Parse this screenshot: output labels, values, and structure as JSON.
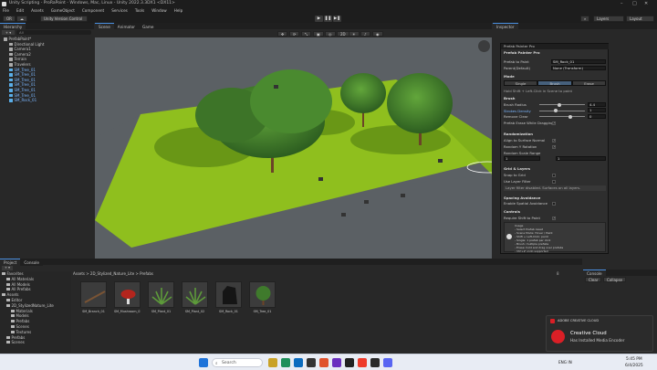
{
  "window": {
    "title": "Unity Scripting - ProRaPoint - Windows, Mac, Linux - Unity 2022.3.3DX1 <DX11>",
    "controls": [
      "–",
      "□",
      "✕"
    ]
  },
  "menu": [
    "File",
    "Edit",
    "Assets",
    "GameObject",
    "Component",
    "Services",
    "Tools",
    "Window",
    "Help"
  ],
  "toolbar": {
    "account": "OR",
    "cloud": "☁",
    "package_label": "Unity Version Control",
    "layers": "Layers",
    "layout": "Layout",
    "search_glyph": "⌕",
    "play": "▶",
    "pause": "❚❚",
    "step": "▶❚"
  },
  "hierarchy": {
    "title": "Hierarchy",
    "add": "+ ▾",
    "search_placeholder": "All",
    "items": [
      {
        "label": "PrefabPaint*",
        "type": "scene"
      },
      {
        "label": "Directional Light",
        "type": "go"
      },
      {
        "label": "Camera1",
        "type": "go"
      },
      {
        "label": "Camera2",
        "type": "go"
      },
      {
        "label": "Terrain",
        "type": "go"
      },
      {
        "label": "Travelers",
        "type": "go"
      },
      {
        "label": "SM_Tree_01",
        "type": "prefab"
      },
      {
        "label": "SM_Tree_01",
        "type": "prefab"
      },
      {
        "label": "SM_Tree_01",
        "type": "prefab"
      },
      {
        "label": "SM_Tree_01",
        "type": "prefab"
      },
      {
        "label": "SM_Tree_01",
        "type": "prefab"
      },
      {
        "label": "SM_Tree_01",
        "type": "prefab"
      },
      {
        "label": "SM_Rock_01",
        "type": "prefab"
      }
    ]
  },
  "scene": {
    "tabs": [
      "Scene",
      "Animator",
      "Game"
    ],
    "tool_labels": [
      "✥",
      "⟳",
      "⤡",
      "▣",
      "◎",
      "2D",
      "☀",
      "♪",
      "◉"
    ],
    "persp": "< Persp"
  },
  "inspector": {
    "title": "Inspector"
  },
  "overlay": {
    "title": "Prefab Painter Pro",
    "subtitle": "Prefab Painter Pro",
    "prefab_label": "Prefab to Paint",
    "prefab_value": "SM_Rock_01",
    "parent_label": "Parent(Default)",
    "parent_value": "None (Transform)",
    "mode_label": "Mode",
    "modes": [
      "Single",
      "Brush",
      "Erase"
    ],
    "active_mode": 1,
    "hint": "Hold Shift + Left-Click in Scene to paint",
    "brush_label": "Brush",
    "fields": [
      {
        "label": "Brush Radius",
        "value": "4.4"
      },
      {
        "label": "Strokes Density",
        "value": "1"
      },
      {
        "label": "Remove Clear",
        "value": "0"
      }
    ],
    "strokes_dropdown": "Prefab Erase While Dragging",
    "randomization_label": "Randomization",
    "rand_items": [
      {
        "label": "Align to Surface Normal",
        "checked": true
      },
      {
        "label": "Random Y Rotation",
        "checked": true
      }
    ],
    "scale_label": "Random Scale Range",
    "scale_min": "1",
    "scale_max": "1",
    "grid_label": "Grid & Layers",
    "grid_items": [
      {
        "label": "Snap to Grid",
        "checked": false
      },
      {
        "label": "Use Layer Filter",
        "checked": false
      }
    ],
    "layer_hint": "Layer filter disabled. Surfaces on all layers.",
    "spacing_label": "Spacing Avoidance",
    "spacing_item": "Enable Spatial Avoidance",
    "controls_label": "Controls",
    "controls_item": "Require Shift to Paint",
    "help_title": "Usage",
    "help_lines": [
      "- Select Prefab Asset",
      "- Scene Mode: Hover / Paint",
      "- Shift + Left-Click: paint",
      "- Single: 1 prefab per click",
      "- Brush: multiple prefabs",
      "- Erase: hold and drag over prefabs",
      "- Ctrl+Z undo supported"
    ]
  },
  "project": {
    "tabs": [
      "Project",
      "Console"
    ],
    "add": "+ ▾",
    "breadcrumb": "Assets > 2D_Stylized_Nature_Lite > Prefabs",
    "tree": [
      {
        "label": "Favorites",
        "level": 0
      },
      {
        "label": "All Materials",
        "level": 1
      },
      {
        "label": "All Models",
        "level": 1
      },
      {
        "label": "All Prefabs",
        "level": 1
      },
      {
        "label": "Assets",
        "level": 0
      },
      {
        "label": "Editor",
        "level": 1
      },
      {
        "label": "2D_StylizedNature_Lite",
        "level": 1
      },
      {
        "label": "Materials",
        "level": 2
      },
      {
        "label": "Models",
        "level": 2
      },
      {
        "label": "Prefabs",
        "level": 2
      },
      {
        "label": "Scenes",
        "level": 2
      },
      {
        "label": "Textures",
        "level": 2
      },
      {
        "label": "Prefabs",
        "level": 1
      },
      {
        "label": "Scenes",
        "level": 1
      }
    ],
    "assets": [
      {
        "label": "SM_Branch_01",
        "icon": "branch"
      },
      {
        "label": "SM_Mushroom_01",
        "icon": "mushroom"
      },
      {
        "label": "SM_Plant_01",
        "icon": "plant"
      },
      {
        "label": "SM_Plant_02",
        "icon": "plant"
      },
      {
        "label": "SM_Rock_01",
        "icon": "rock"
      },
      {
        "label": "SM_Tree_01",
        "icon": "tree"
      }
    ],
    "count": "8"
  },
  "console": {
    "title": "Console",
    "buttons": [
      "Clear",
      "Collapse"
    ]
  },
  "notification": {
    "app": "ADOBE CREATIVE CLOUD",
    "title": "Creative Cloud",
    "body": "Has Installed Media Encoder"
  },
  "taskbar": {
    "search_placeholder": "Search",
    "time": "5:45 PM",
    "date": "6/4/2025",
    "lang": "ENG IN"
  },
  "colors": {
    "accent": "#4a90e2",
    "grass": "#8fbf1e",
    "tree": "#3f7a2c"
  }
}
